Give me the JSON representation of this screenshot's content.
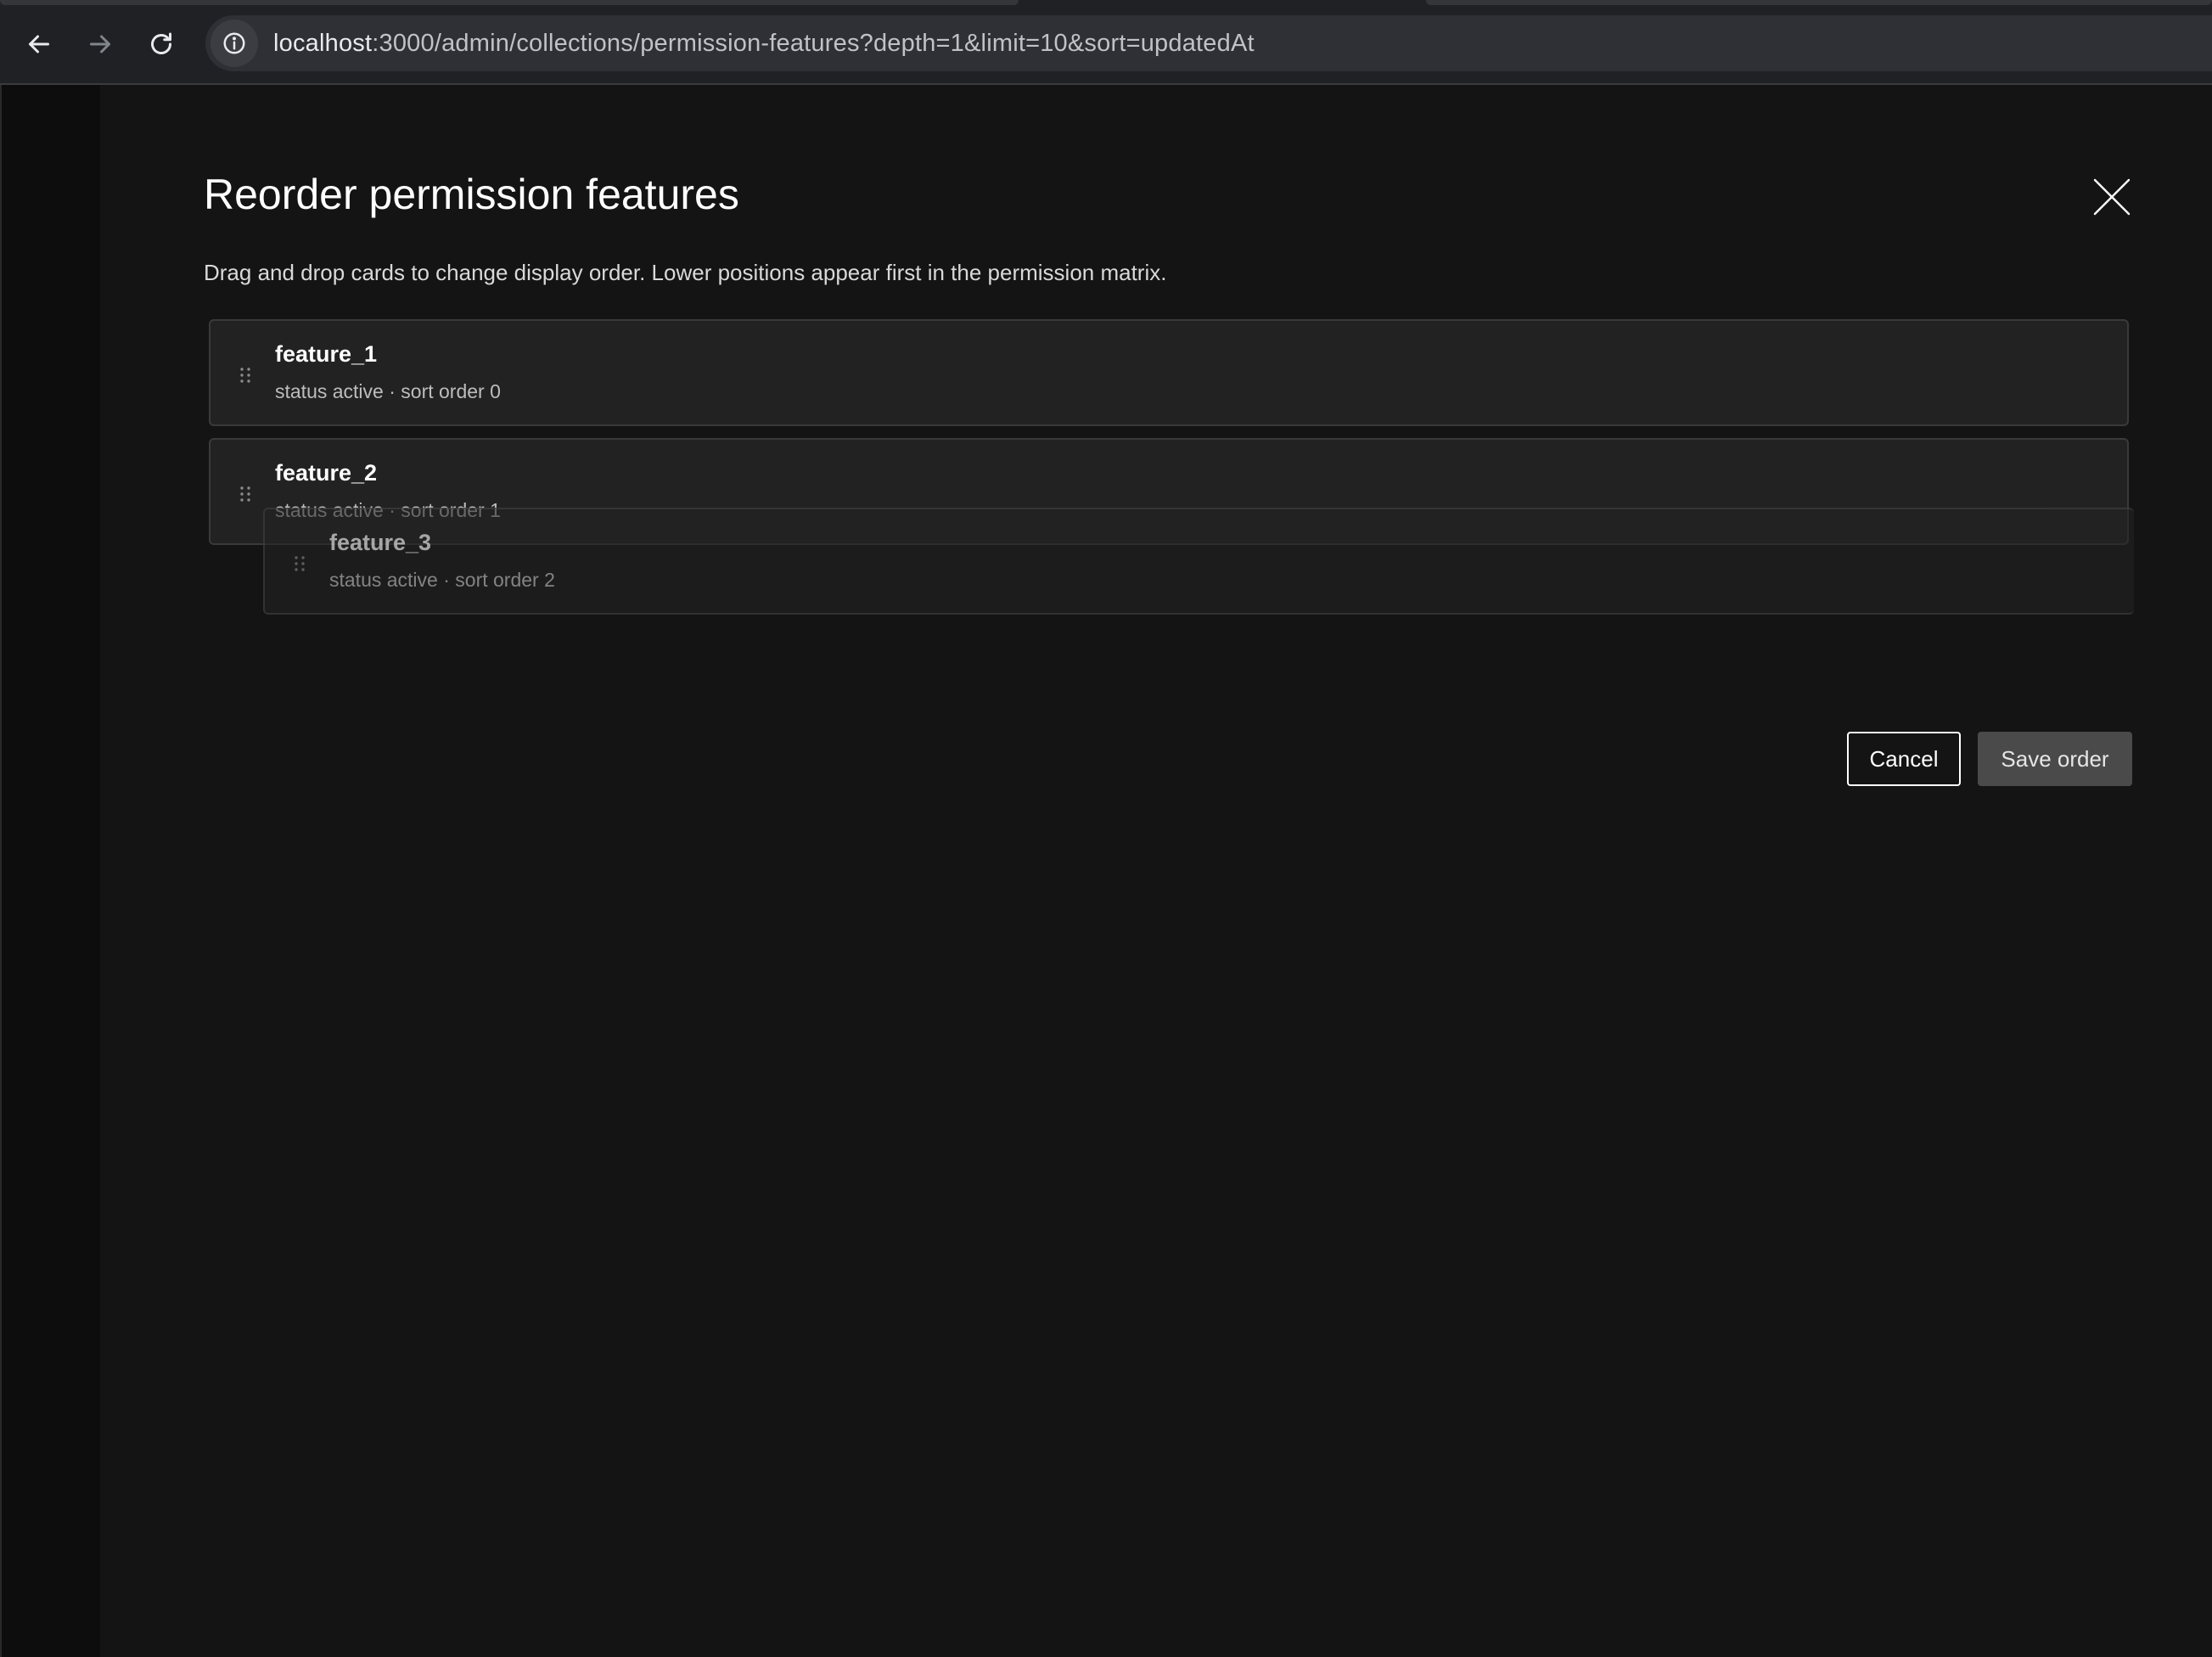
{
  "browser": {
    "url_host": "localhost",
    "url_rest": ":3000/admin/collections/permission-features?depth=1&limit=10&sort=updatedAt",
    "icons": {
      "back": "arrow-left-icon",
      "forward": "arrow-right-icon",
      "reload": "reload-icon",
      "site_info": "info-icon"
    }
  },
  "modal": {
    "title": "Reorder permission features",
    "description": "Drag and drop cards to change display order. Lower positions appear first in the permission matrix.",
    "close_icon": "close-icon",
    "cards": [
      {
        "title": "feature_1",
        "meta": "status active · sort order 0"
      },
      {
        "title": "feature_2",
        "meta": "status active · sort order 1"
      },
      {
        "title": "feature_3",
        "meta": "status active · sort order 2",
        "dragging": true
      }
    ],
    "cancel_label": "Cancel",
    "save_label": "Save order"
  },
  "colors": {
    "background": "#141414",
    "card": "#222222",
    "card_border": "#3a3a3a",
    "save_button": "#4a4a4a"
  }
}
